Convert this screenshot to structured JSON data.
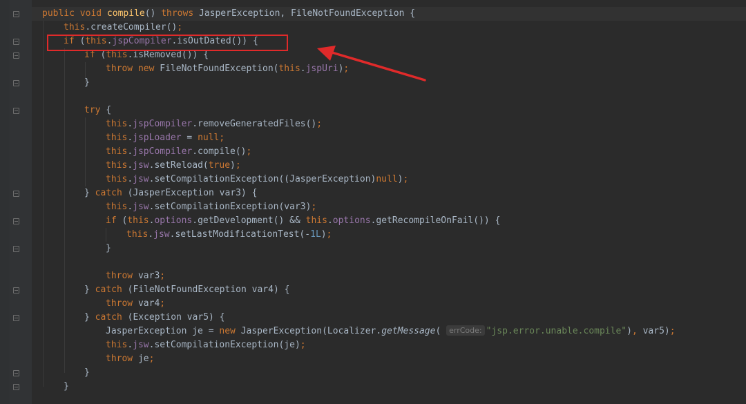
{
  "editor": {
    "lines": [
      {
        "id": "l1",
        "text": "public void compile() throws JasperException, FileNotFoundException {"
      },
      {
        "id": "l2",
        "text": "this.createCompiler();"
      },
      {
        "id": "l3",
        "text": "if (this.jspCompiler.isOutDated()) {"
      },
      {
        "id": "l4",
        "text": "if (this.isRemoved()) {"
      },
      {
        "id": "l5",
        "text": "throw new FileNotFoundException(this.jspUri);"
      },
      {
        "id": "l6",
        "text": "}"
      },
      {
        "id": "l7",
        "text": "try {"
      },
      {
        "id": "l8",
        "text": "this.jspCompiler.removeGeneratedFiles();"
      },
      {
        "id": "l9",
        "text": "this.jspLoader = null;"
      },
      {
        "id": "l10",
        "text": "this.jspCompiler.compile();"
      },
      {
        "id": "l11",
        "text": "this.jsw.setReload(true);"
      },
      {
        "id": "l12",
        "text": "this.jsw.setCompilationException((JasperException)null);"
      },
      {
        "id": "l13",
        "text": "} catch (JasperException var3) {"
      },
      {
        "id": "l14",
        "text": "this.jsw.setCompilationException(var3);"
      },
      {
        "id": "l15",
        "text": "if (this.options.getDevelopment() && this.options.getRecompileOnFail()) {"
      },
      {
        "id": "l16",
        "text": "this.jsw.setLastModificationTest(-1L);"
      },
      {
        "id": "l17",
        "text": "}"
      },
      {
        "id": "l18",
        "text": "throw var3;"
      },
      {
        "id": "l19",
        "text": "} catch (FileNotFoundException var4) {"
      },
      {
        "id": "l20",
        "text": "throw var4;"
      },
      {
        "id": "l21",
        "text": "} catch (Exception var5) {"
      },
      {
        "id": "l22",
        "text": "JasperException je = new JasperException(Localizer.getMessage( errCode: \"jsp.error.unable.compile\"), var5);"
      },
      {
        "id": "l23",
        "text": "this.jsw.setCompilationException(je);"
      },
      {
        "id": "l24",
        "text": "throw je;"
      },
      {
        "id": "l25",
        "text": "}"
      },
      {
        "id": "l26",
        "text": "}"
      }
    ],
    "param_hint": "errCode:"
  },
  "annotation": {
    "box_color": "#e02a2a",
    "arrow_color": "#e02a2a"
  },
  "colors": {
    "background": "#2b2b2b",
    "keyword": "#cc7832",
    "method_decl": "#ffc66d",
    "field": "#9876aa",
    "number": "#6897bb",
    "string": "#6a8759",
    "default": "#a9b7c6"
  }
}
